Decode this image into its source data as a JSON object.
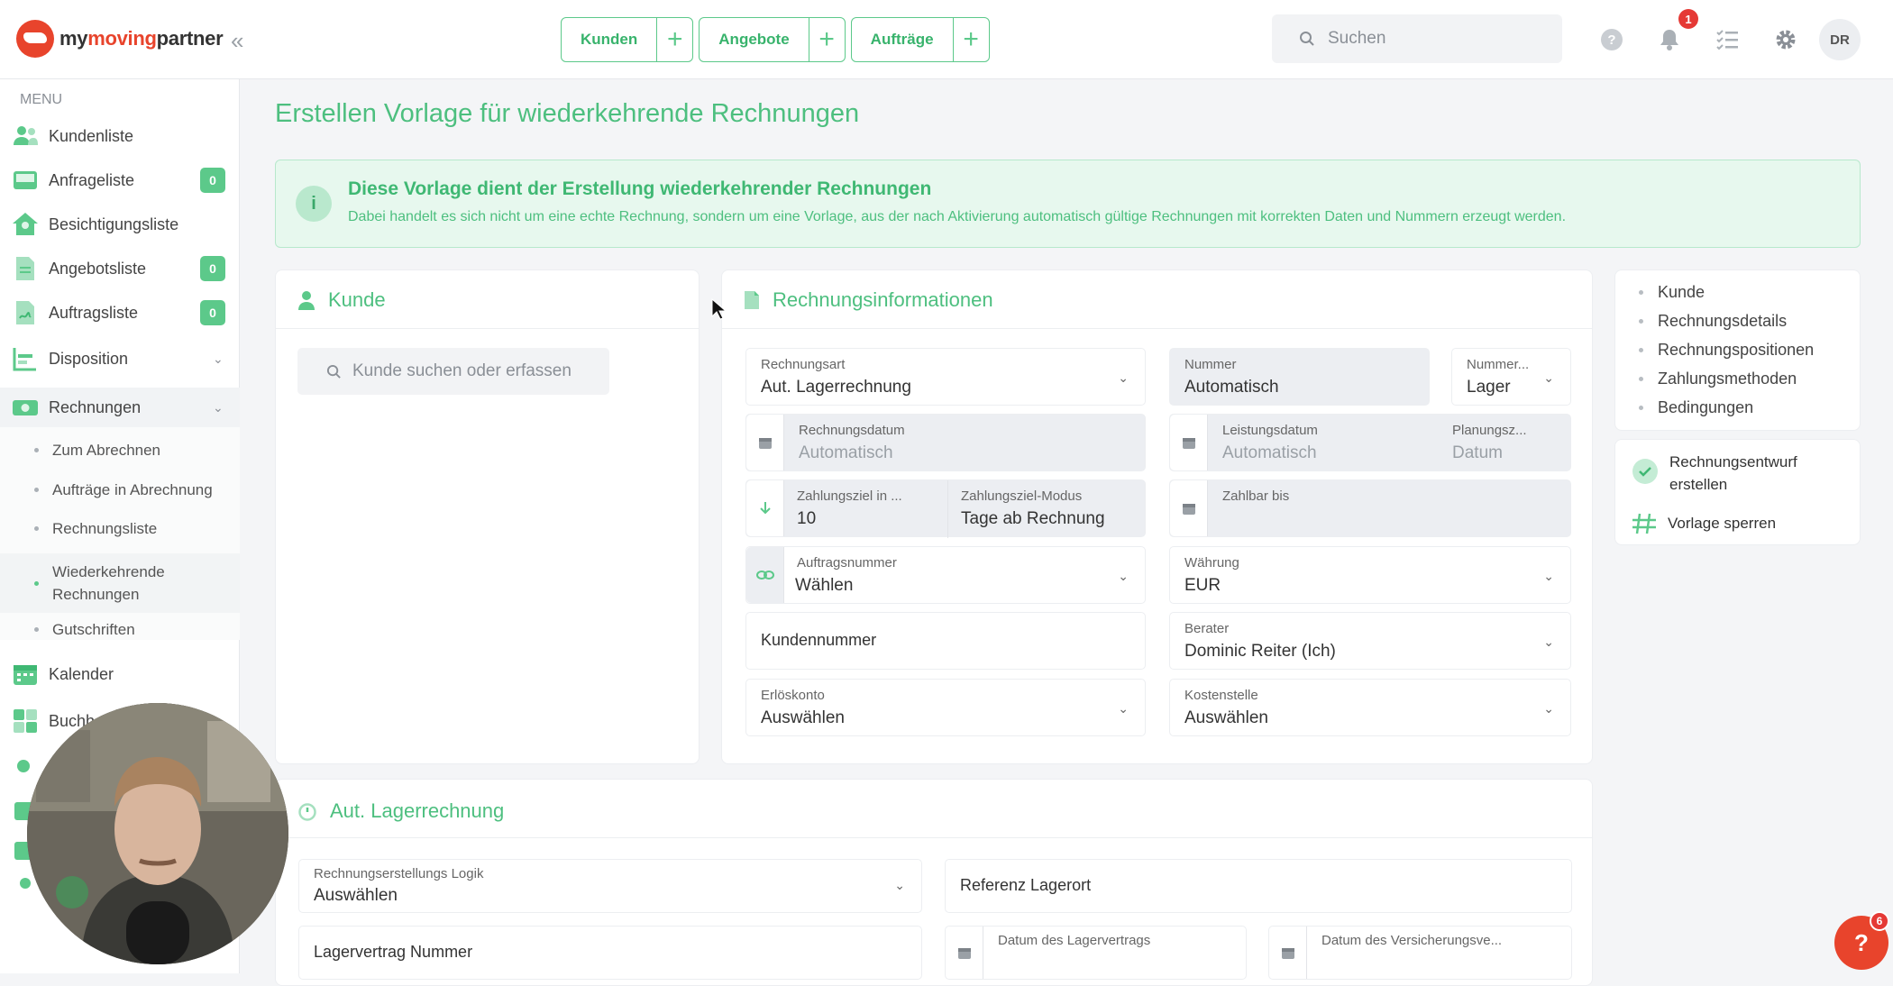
{
  "brand": {
    "name_part1": "my",
    "name_part2": "moving",
    "name_part3": "partner"
  },
  "topbar": {
    "quick": [
      {
        "label": "Kunden"
      },
      {
        "label": "Angebote"
      },
      {
        "label": "Aufträge"
      }
    ],
    "search_placeholder": "Suchen",
    "notification_count": "1",
    "user_initials": "DR"
  },
  "sidebar": {
    "menu_title": "MENU",
    "items": [
      {
        "label": "Kundenliste"
      },
      {
        "label": "Anfrageliste",
        "badge": "0"
      },
      {
        "label": "Besichtigungsliste"
      },
      {
        "label": "Angebotsliste",
        "badge": "0"
      },
      {
        "label": "Auftragsliste",
        "badge": "0"
      },
      {
        "label": "Disposition"
      },
      {
        "label": "Rechnungen"
      },
      {
        "label": "Kalender"
      },
      {
        "label": "Buchh"
      }
    ],
    "sub": [
      {
        "label": "Zum Abrechnen"
      },
      {
        "label": "Aufträge in Abrechnung"
      },
      {
        "label": "Rechnungsliste"
      },
      {
        "label": "Wiederkehrende Rechnungen"
      },
      {
        "label": "Gutschriften"
      }
    ]
  },
  "page": {
    "title": "Erstellen Vorlage für wiederkehrende Rechnungen",
    "info_title": "Diese Vorlage dient der Erstellung wiederkehrender Rechnungen",
    "info_text": "Dabei handelt es sich nicht um eine echte Rechnung, sondern um eine Vorlage, aus der nach Aktivierung automatisch gültige Rechnungen mit korrekten Daten und Nummern erzeugt werden."
  },
  "kunde": {
    "title": "Kunde",
    "search_placeholder": "Kunde suchen oder erfassen"
  },
  "rechnung": {
    "title": "Rechnungsinformationen",
    "rechnungsart_label": "Rechnungsart",
    "rechnungsart_value": "Aut. Lagerrechnung",
    "nummer_label": "Nummer",
    "nummer_value": "Automatisch",
    "nummerkreis_label": "Nummer...",
    "nummerkreis_value": "Lager",
    "rechnungsdatum_label": "Rechnungsdatum",
    "rechnungsdatum_value": "Automatisch",
    "leistungsdatum_label": "Leistungsdatum",
    "leistungsdatum_value": "Automatisch",
    "planungs_label": "Planungsz...",
    "planungs_value": "Datum",
    "zahlungsziel_label": "Zahlungsziel in ...",
    "zahlungsziel_value": "10",
    "zzmodus_label": "Zahlungsziel-Modus",
    "zzmodus_value": "Tage ab Rechnung",
    "zahlbar_label": "Zahlbar bis",
    "auftrag_label": "Auftragsnummer",
    "auftrag_value": "Wählen",
    "waehrung_label": "Währung",
    "waehrung_value": "EUR",
    "kundennummer_label": "Kundennummer",
    "berater_label": "Berater",
    "berater_value": "Dominic Reiter (Ich)",
    "erloes_label": "Erlöskonto",
    "erloes_value": "Auswählen",
    "kosten_label": "Kostenstelle",
    "kosten_value": "Auswählen"
  },
  "nav": {
    "items": [
      {
        "label": "Kunde"
      },
      {
        "label": "Rechnungsdetails"
      },
      {
        "label": "Rechnungspositionen"
      },
      {
        "label": "Zahlungsmethoden"
      },
      {
        "label": "Bedingungen"
      }
    ],
    "action1_line1": "Rechnungsentwurf",
    "action1_line2": "erstellen",
    "action2": "Vorlage sperren"
  },
  "lager": {
    "title": "Aut. Lagerrechnung",
    "logik_label": "Rechnungserstellungs Logik",
    "logik_value": "Auswählen",
    "referenz_label": "Referenz Lagerort",
    "vertrag_label": "Lagervertrag Nummer",
    "datum_vertrag_label": "Datum des Lagervertrags",
    "datum_vers_label": "Datum des Versicherungsve..."
  },
  "help": {
    "label": "?",
    "count": "6"
  },
  "colors": {
    "accent": "#4dbf7f",
    "brand": "#e8442c"
  }
}
